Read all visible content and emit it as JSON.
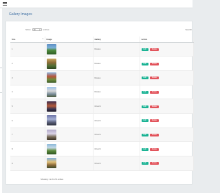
{
  "page": {
    "title": "Gallery Images"
  },
  "controls": {
    "show_label": "Show",
    "entries_value": "10",
    "entries_label": "entries",
    "search_label": "Search"
  },
  "table": {
    "columns": [
      "Sno",
      "Image",
      "Gallery",
      "Action"
    ],
    "rows": [
      {
        "sno": "1",
        "gallery": "Movies"
      },
      {
        "sno": "2",
        "gallery": "Movies"
      },
      {
        "sno": "3",
        "gallery": "Movies"
      },
      {
        "sno": "4",
        "gallery": "Movies"
      },
      {
        "sno": "5",
        "gallery": "Church"
      },
      {
        "sno": "6",
        "gallery": "Church"
      },
      {
        "sno": "7",
        "gallery": "Church"
      },
      {
        "sno": "8",
        "gallery": "Church"
      },
      {
        "sno": "9",
        "gallery": "Church"
      }
    ],
    "edit_label": "Edit",
    "delete_label": "Delete"
  },
  "footer": {
    "info": "Showing 1 to 9 of 9 entries"
  },
  "colors": {
    "edit": "#1bb394",
    "delete": "#e2545c",
    "title": "#3e6fa3"
  }
}
